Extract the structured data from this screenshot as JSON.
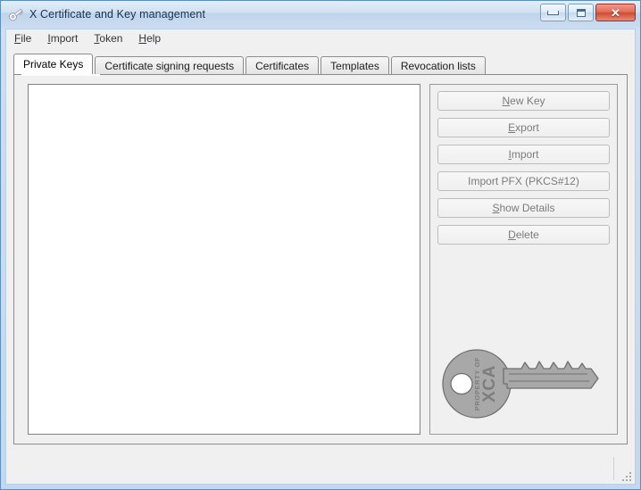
{
  "window": {
    "title": "X Certificate and Key management",
    "icon": "key-icon",
    "controls": {
      "minimize": "minimize-icon",
      "maximize": "maximize-icon",
      "close": "✕"
    }
  },
  "menubar": {
    "items": [
      {
        "label": "File",
        "mnemonic": "F",
        "rest": "ile"
      },
      {
        "label": "Import",
        "mnemonic": "I",
        "rest": "mport"
      },
      {
        "label": "Token",
        "mnemonic": "T",
        "rest": "oken"
      },
      {
        "label": "Help",
        "mnemonic": "H",
        "rest": "elp"
      }
    ]
  },
  "tabs": {
    "active_index": 0,
    "items": [
      {
        "label": "Private Keys"
      },
      {
        "label": "Certificate signing requests"
      },
      {
        "label": "Certificates"
      },
      {
        "label": "Templates"
      },
      {
        "label": "Revocation lists"
      }
    ]
  },
  "list": {
    "items": [],
    "empty": true
  },
  "buttons": [
    {
      "mnemonic": "N",
      "rest": "ew Key",
      "prefix": "",
      "label": "New Key",
      "enabled": false
    },
    {
      "mnemonic": "E",
      "rest": "xport",
      "prefix": "",
      "label": "Export",
      "enabled": false
    },
    {
      "mnemonic": "I",
      "rest": "mport",
      "prefix": "",
      "label": "Import",
      "enabled": false
    },
    {
      "mnemonic": "",
      "rest": "",
      "prefix": "Import PFX (PKCS#12)",
      "label": "Import PFX (PKCS#12)",
      "enabled": false
    },
    {
      "mnemonic": "S",
      "rest": "how Details",
      "prefix": "",
      "label": "Show Details",
      "enabled": false
    },
    {
      "mnemonic": "D",
      "rest": "elete",
      "prefix": "",
      "label": "Delete",
      "enabled": false
    }
  ],
  "watermark": {
    "line1": "PROPERTY OF",
    "line2": "XCA"
  },
  "statusbar": {
    "text": ""
  },
  "colors": {
    "titlebar": "#cfe0f2",
    "frame_border": "#5a8fc4",
    "close_button": "#cf4a32",
    "panel_bg": "#f0f0f0",
    "list_bg": "#ffffff",
    "button_text": "#7b7b7b",
    "watermark_fill": "#a8a8a8"
  }
}
